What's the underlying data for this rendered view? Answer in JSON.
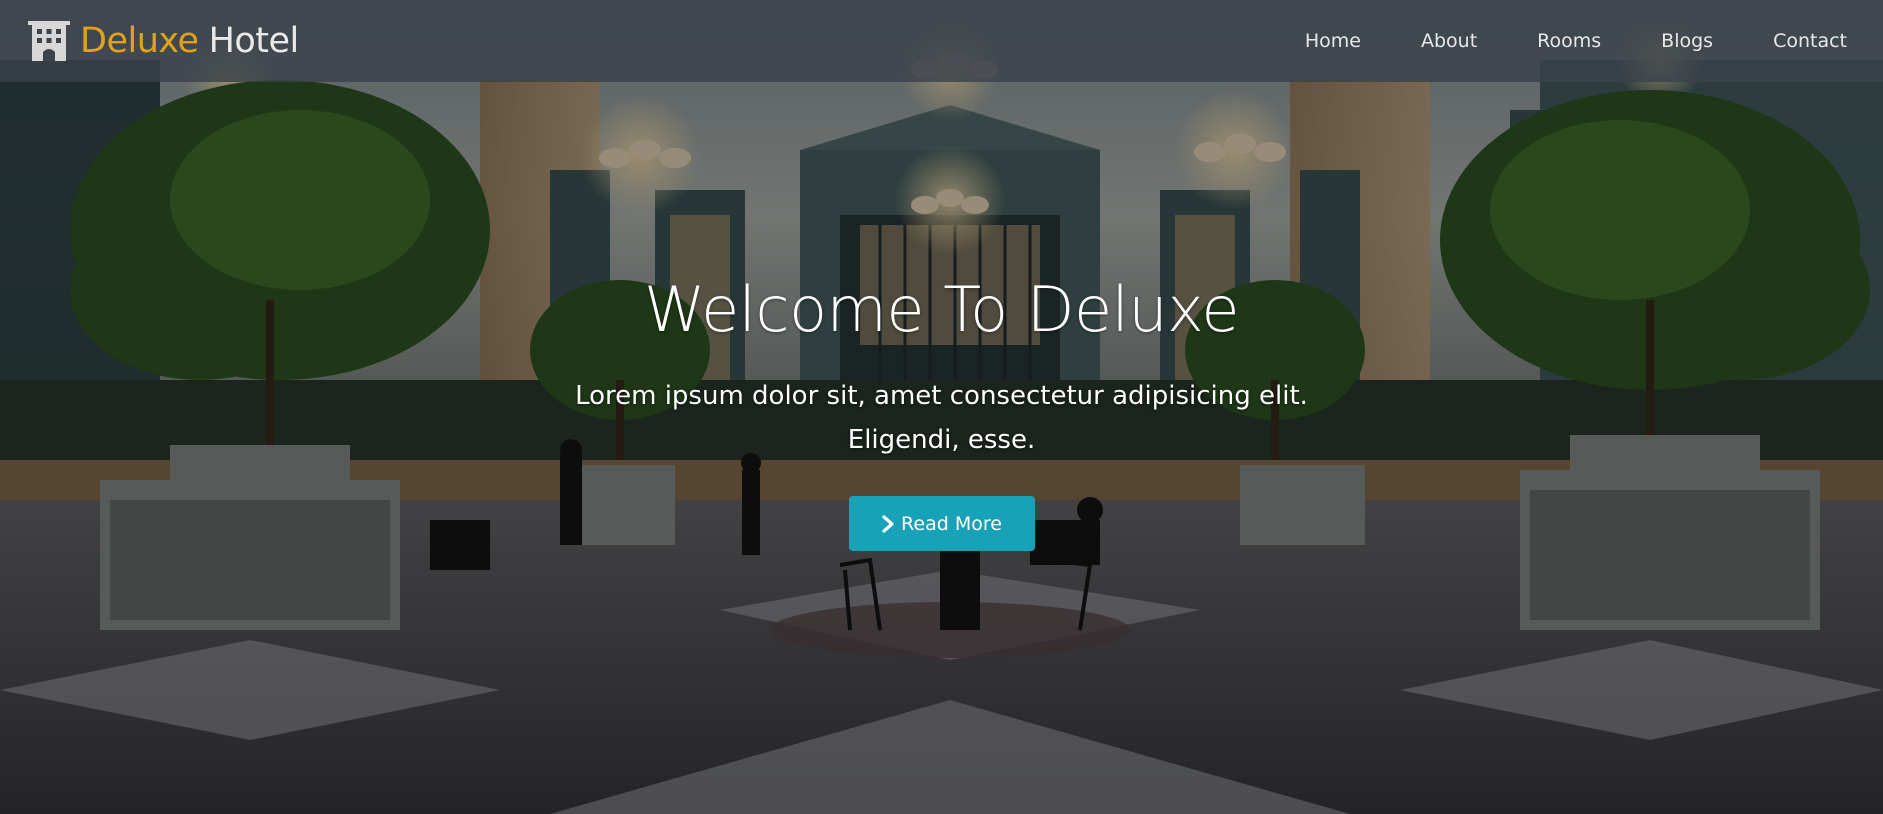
{
  "brand": {
    "name": "Deluxe",
    "suffix": "Hotel",
    "icon": "hotel-building-icon",
    "accent_color": "#e0a21b"
  },
  "nav": {
    "items": [
      {
        "label": "Home"
      },
      {
        "label": "About"
      },
      {
        "label": "Rooms"
      },
      {
        "label": "Blogs"
      },
      {
        "label": "Contact"
      }
    ]
  },
  "hero": {
    "title": "Welcome To Deluxe",
    "text": "Lorem ipsum dolor sit, amet consectetur adipisicing elit. Eligendi, esse.",
    "button": {
      "label": "Read More",
      "icon": "chevron-right-icon",
      "color": "#17a2b8"
    },
    "background_image": "hotel-lobby-photo"
  }
}
